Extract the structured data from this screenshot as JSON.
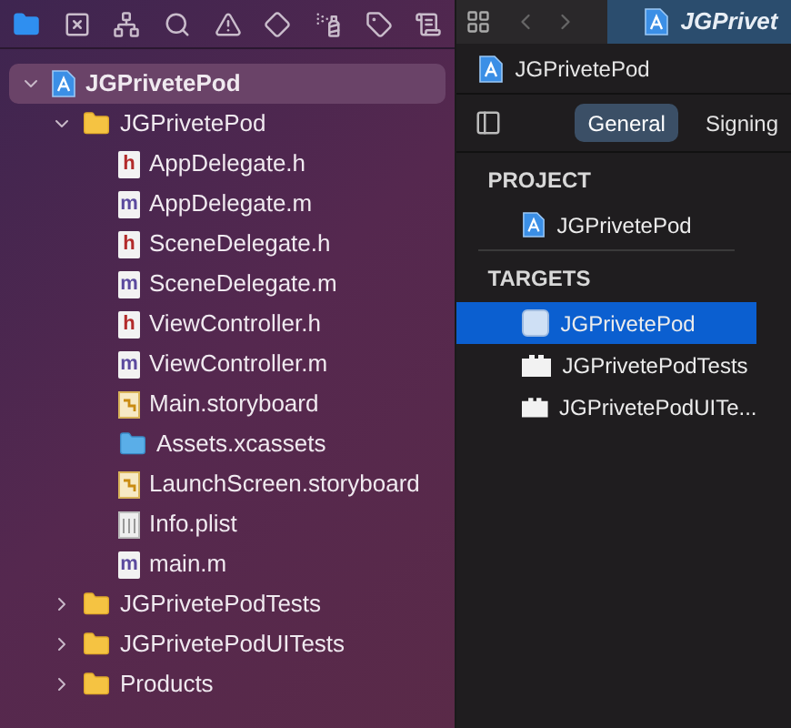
{
  "navigator_toolbar": [
    {
      "selected": true
    },
    {
      "selected": false
    },
    {
      "selected": false
    },
    {
      "selected": false
    },
    {
      "selected": false
    },
    {
      "selected": false
    },
    {
      "selected": false
    },
    {
      "selected": false
    },
    {
      "selected": false
    }
  ],
  "tree": {
    "label": "JGPrivetePod",
    "kind": "project",
    "expanded": true,
    "selected": true,
    "children": [
      {
        "label": "JGPrivetePod",
        "kind": "group",
        "expanded": true,
        "selected": false,
        "children": [
          {
            "label": "AppDelegate.h",
            "kind": "source",
            "badge": "h",
            "selected": false
          },
          {
            "label": "AppDelegate.m",
            "kind": "source",
            "badge": "m",
            "selected": false
          },
          {
            "label": "SceneDelegate.h",
            "kind": "source",
            "badge": "h",
            "selected": false
          },
          {
            "label": "SceneDelegate.m",
            "kind": "source",
            "badge": "m",
            "selected": false
          },
          {
            "label": "ViewController.h",
            "kind": "source",
            "badge": "h",
            "selected": false
          },
          {
            "label": "ViewController.m",
            "kind": "source",
            "badge": "m",
            "selected": false
          },
          {
            "label": "Main.storyboard",
            "kind": "storyboard",
            "selected": false
          },
          {
            "label": "Assets.xcassets",
            "kind": "assets",
            "selected": false
          },
          {
            "label": "LaunchScreen.storyboard",
            "kind": "storyboard",
            "selected": false
          },
          {
            "label": "Info.plist",
            "kind": "plist",
            "selected": false
          },
          {
            "label": "main.m",
            "kind": "source",
            "badge": "m",
            "selected": false
          }
        ]
      },
      {
        "label": "JGPrivetePodTests",
        "kind": "group",
        "expanded": false,
        "selected": false
      },
      {
        "label": "JGPrivetePodUITests",
        "kind": "group",
        "expanded": false,
        "selected": false
      },
      {
        "label": "Products",
        "kind": "group",
        "expanded": false,
        "selected": false
      }
    ]
  },
  "editor_tab": {
    "label": "JGPrivet",
    "selected": true
  },
  "breadcrumb": "JGPrivetePod",
  "settings_tabs": [
    {
      "label": "General",
      "selected": true
    },
    {
      "label": "Signing",
      "selected": false
    }
  ],
  "project_section": {
    "header": "PROJECT",
    "items": [
      {
        "label": "JGPrivetePod",
        "kind": "project",
        "selected": false
      }
    ]
  },
  "targets_section": {
    "header": "TARGETS",
    "items": [
      {
        "label": "JGPrivetePod",
        "kind": "app",
        "selected": true
      },
      {
        "label": "JGPrivetePodTests",
        "kind": "bundle",
        "selected": false
      },
      {
        "label": "JGPrivetePodUITe...",
        "kind": "bundle",
        "selected": false
      }
    ]
  }
}
